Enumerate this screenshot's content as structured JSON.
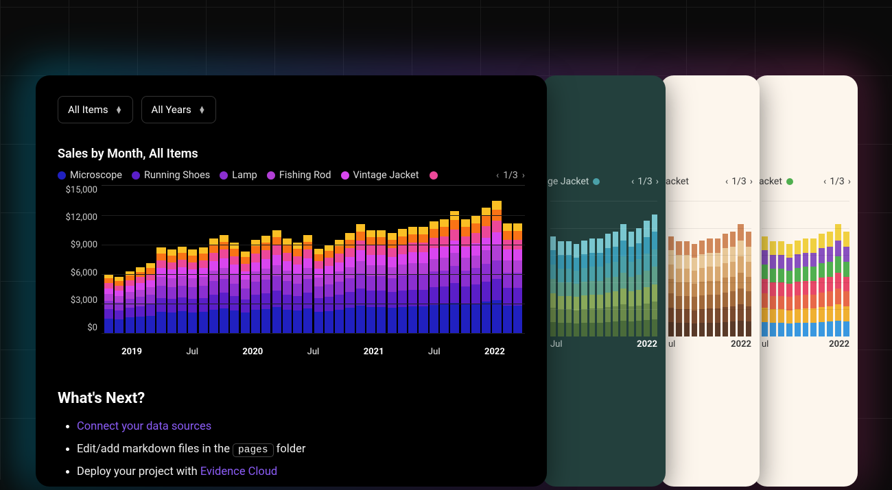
{
  "filters": {
    "items": "All Items",
    "years": "All Years"
  },
  "chart_data": {
    "type": "bar",
    "title": "Sales by Month, All Items",
    "ylabel": "",
    "xlabel": "",
    "ylim": [
      0,
      15000
    ],
    "yticks": [
      "$15,000",
      "$12,000",
      "$9,000",
      "$6,000",
      "$3,000",
      "$0"
    ],
    "xticks": [
      {
        "label": "2019",
        "bold": true
      },
      {
        "label": "Jul"
      },
      {
        "label": "2020",
        "bold": true
      },
      {
        "label": "Jul"
      },
      {
        "label": "2021",
        "bold": true
      },
      {
        "label": "Jul"
      },
      {
        "label": "2022",
        "bold": true
      }
    ],
    "legend": {
      "items": [
        {
          "name": "Microscope",
          "color": "#2020c0"
        },
        {
          "name": "Running Shoes",
          "color": "#5a1ec8"
        },
        {
          "name": "Lamp",
          "color": "#8b2fd0"
        },
        {
          "name": "Fishing Rod",
          "color": "#b23fd6"
        },
        {
          "name": "Vintage Jacket",
          "color": "#d946ef"
        }
      ],
      "page": "1/3"
    },
    "series_colors": [
      "#2020c0",
      "#5a1ec8",
      "#8b2fd0",
      "#b23fd6",
      "#d946ef",
      "#ec4899",
      "#f97316",
      "#fbbf24"
    ],
    "categories": [
      "2019-01",
      "2019-02",
      "2019-03",
      "2019-04",
      "2019-05",
      "2019-06",
      "2019-07",
      "2019-08",
      "2019-09",
      "2019-10",
      "2019-11",
      "2019-12",
      "2020-01",
      "2020-02",
      "2020-03",
      "2020-04",
      "2020-05",
      "2020-06",
      "2020-07",
      "2020-08",
      "2020-09",
      "2020-10",
      "2020-11",
      "2020-12",
      "2021-01",
      "2021-02",
      "2021-03",
      "2021-04",
      "2021-05",
      "2021-06",
      "2021-07",
      "2021-08",
      "2021-09",
      "2021-10",
      "2021-11",
      "2021-12"
    ],
    "totals": [
      6000,
      5700,
      6300,
      6700,
      7100,
      8700,
      8500,
      8800,
      8500,
      8700,
      9600,
      10000,
      9200,
      8300,
      9500,
      9900,
      10500,
      9600,
      9200,
      10000,
      8600,
      9000,
      9500,
      10200,
      11100,
      10500,
      10500,
      10200,
      10600,
      10800,
      10800,
      11400,
      11600,
      12400,
      11600,
      12000,
      12800,
      13500,
      11200,
      11200
    ],
    "stack_shares": [
      0.25,
      0.16,
      0.14,
      0.11,
      0.1,
      0.09,
      0.08,
      0.07
    ]
  },
  "pager": {
    "prev": "‹",
    "next": "›",
    "label": "1/3"
  },
  "whats_next": {
    "heading": "What's Next?",
    "items": [
      {
        "type": "link",
        "text": "Connect your data sources"
      },
      {
        "type": "text",
        "prefix": "Edit/add markdown files in the ",
        "code": "pages",
        "suffix": " folder"
      },
      {
        "type": "deploy",
        "prefix": "Deploy your project with ",
        "link": "Evidence Cloud"
      }
    ]
  },
  "mini_cards": [
    {
      "theme": "teal",
      "truncated_legend": "ge Jacket",
      "pager": "1/3",
      "xticks": [
        "Jul",
        "2022"
      ],
      "colors": [
        "#4a6b3a",
        "#6b8a4a",
        "#8aa95a",
        "#5fa08a",
        "#4aa0a8",
        "#3a9bb5",
        "#7ac7d0"
      ]
    },
    {
      "theme": "cream",
      "truncated_legend": "acket",
      "pager": "1/3",
      "xticks": [
        "ul",
        "2022"
      ],
      "colors": [
        "#5a3a28",
        "#7a4a2e",
        "#a0683a",
        "#c08850",
        "#d8a870",
        "#e8c898",
        "#d0885a"
      ]
    },
    {
      "theme": "cream",
      "truncated_legend": "acket",
      "pager": "1/3",
      "xticks": [
        "ul",
        "2022"
      ],
      "colors": [
        "#3998e0",
        "#f0b030",
        "#e86848",
        "#e84868",
        "#50b050",
        "#8850c0",
        "#f0d040"
      ]
    }
  ],
  "mini_totals": [
    11100,
    10500,
    10500,
    10200,
    10600,
    10800,
    10800,
    11400,
    11600,
    12400,
    11600,
    12000,
    12800,
    13500,
    11200,
    11200
  ]
}
